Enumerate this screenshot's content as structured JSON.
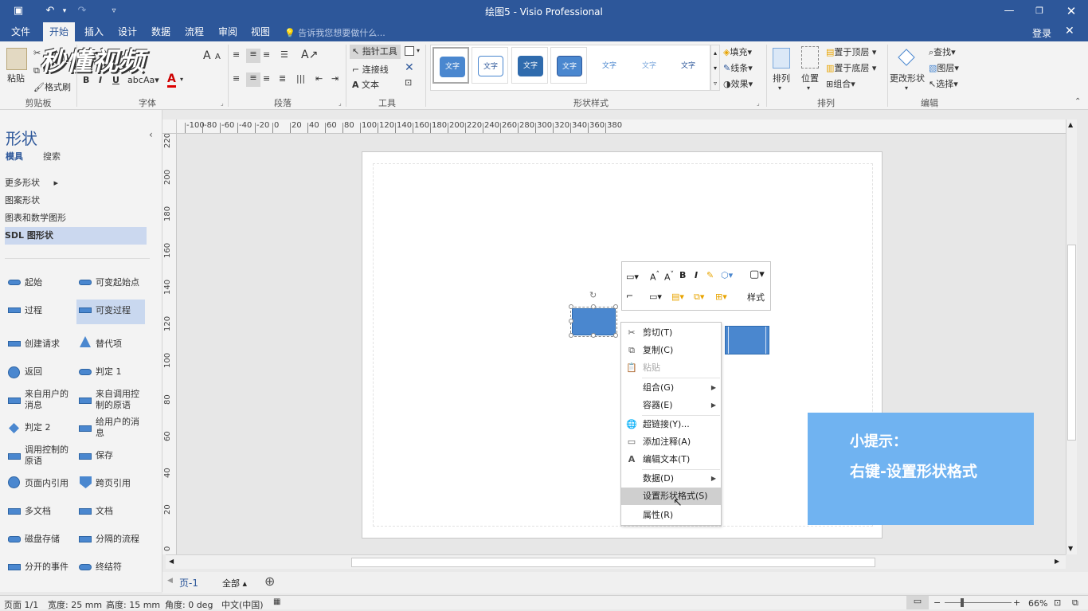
{
  "titlebar": {
    "title": "绘图5 - Visio Professional",
    "save_icon": "save-icon",
    "undo_icon": "undo-icon",
    "redo_icon": "redo-icon"
  },
  "tabs": [
    "文件",
    "开始",
    "插入",
    "设计",
    "数据",
    "流程",
    "审阅",
    "视图"
  ],
  "active_tab": "开始",
  "tellme": "告诉我您想要做什么...",
  "login": "登录",
  "watermark": "秒懂视频",
  "ribbon": {
    "paste": "粘贴",
    "format_painter": "格式刷",
    "groups": {
      "clipboard": "剪贴板",
      "font": "字体",
      "paragraph": "段落",
      "tools": "工具",
      "shape_styles": "形状样式",
      "arrange": "排列",
      "edit": "编辑"
    },
    "pointer_tool": "指针工具",
    "connector": "连接线",
    "text": "文本",
    "swatch_text": "文字",
    "fill": "填充",
    "line": "线条",
    "effects": "效果",
    "arrange": "排列",
    "position": "位置",
    "bring_front": "置于顶层",
    "send_back": "置于底层",
    "group": "组合",
    "change_shape": "更改形状",
    "find": "查找",
    "layers": "图层",
    "select": "选择"
  },
  "shapes_panel": {
    "title": "形状",
    "tab_stencils": "模具",
    "tab_search": "搜索",
    "nav": [
      "更多形状",
      "图案形状",
      "图表和数学图形",
      "SDL 图形状"
    ],
    "items": [
      [
        "起始",
        "可变起始点"
      ],
      [
        "过程",
        "可变过程"
      ],
      [
        "创建请求",
        "替代项"
      ],
      [
        "返回",
        "判定 1"
      ],
      [
        "来自用户的消息",
        "来自调用控制的原语"
      ],
      [
        "判定 2",
        "给用户的消息"
      ],
      [
        "调用控制的原语",
        "保存"
      ],
      [
        "页面内引用",
        "跨页引用"
      ],
      [
        "多文档",
        "文档"
      ],
      [
        "磁盘存储",
        "分隔的流程"
      ],
      [
        "分开的事件",
        "终结符"
      ]
    ]
  },
  "context_menu": {
    "cut": "剪切(T)",
    "copy": "复制(C)",
    "paste": "粘贴",
    "group": "组合(G)",
    "container": "容器(E)",
    "hyperlink": "超链接(Y)...",
    "add_comment": "添加注释(A)",
    "edit_text": "编辑文本(T)",
    "data": "数据(D)",
    "format_shape": "设置形状格式(S)",
    "properties": "属性(R)"
  },
  "mini_toolbar": {
    "style_label": "样式"
  },
  "tip": {
    "line1": "小提示：",
    "line2": "右键-设置形状格式"
  },
  "page_tabs": {
    "page": "页-1",
    "all": "全部"
  },
  "status": {
    "page": "页面 1/1",
    "width": "宽度: 25 mm",
    "height": "高度: 15 mm",
    "angle": "角度: 0 deg",
    "lang": "中文(中国)",
    "zoom": "66%"
  },
  "hruler": [
    "-100",
    "-80",
    "-60",
    "-40",
    "-20",
    "0",
    "20",
    "40",
    "60",
    "80",
    "100",
    "120",
    "140",
    "160",
    "180",
    "200",
    "220",
    "240",
    "260",
    "280",
    "300",
    "320",
    "340",
    "360",
    "380"
  ],
  "vruler": [
    "220",
    "200",
    "180",
    "160",
    "140",
    "120",
    "100",
    "80",
    "60",
    "40",
    "20",
    "0"
  ],
  "colors": {
    "accent": "#2d579a",
    "shape": "#4a87cf",
    "tip": "#70b3f1"
  }
}
